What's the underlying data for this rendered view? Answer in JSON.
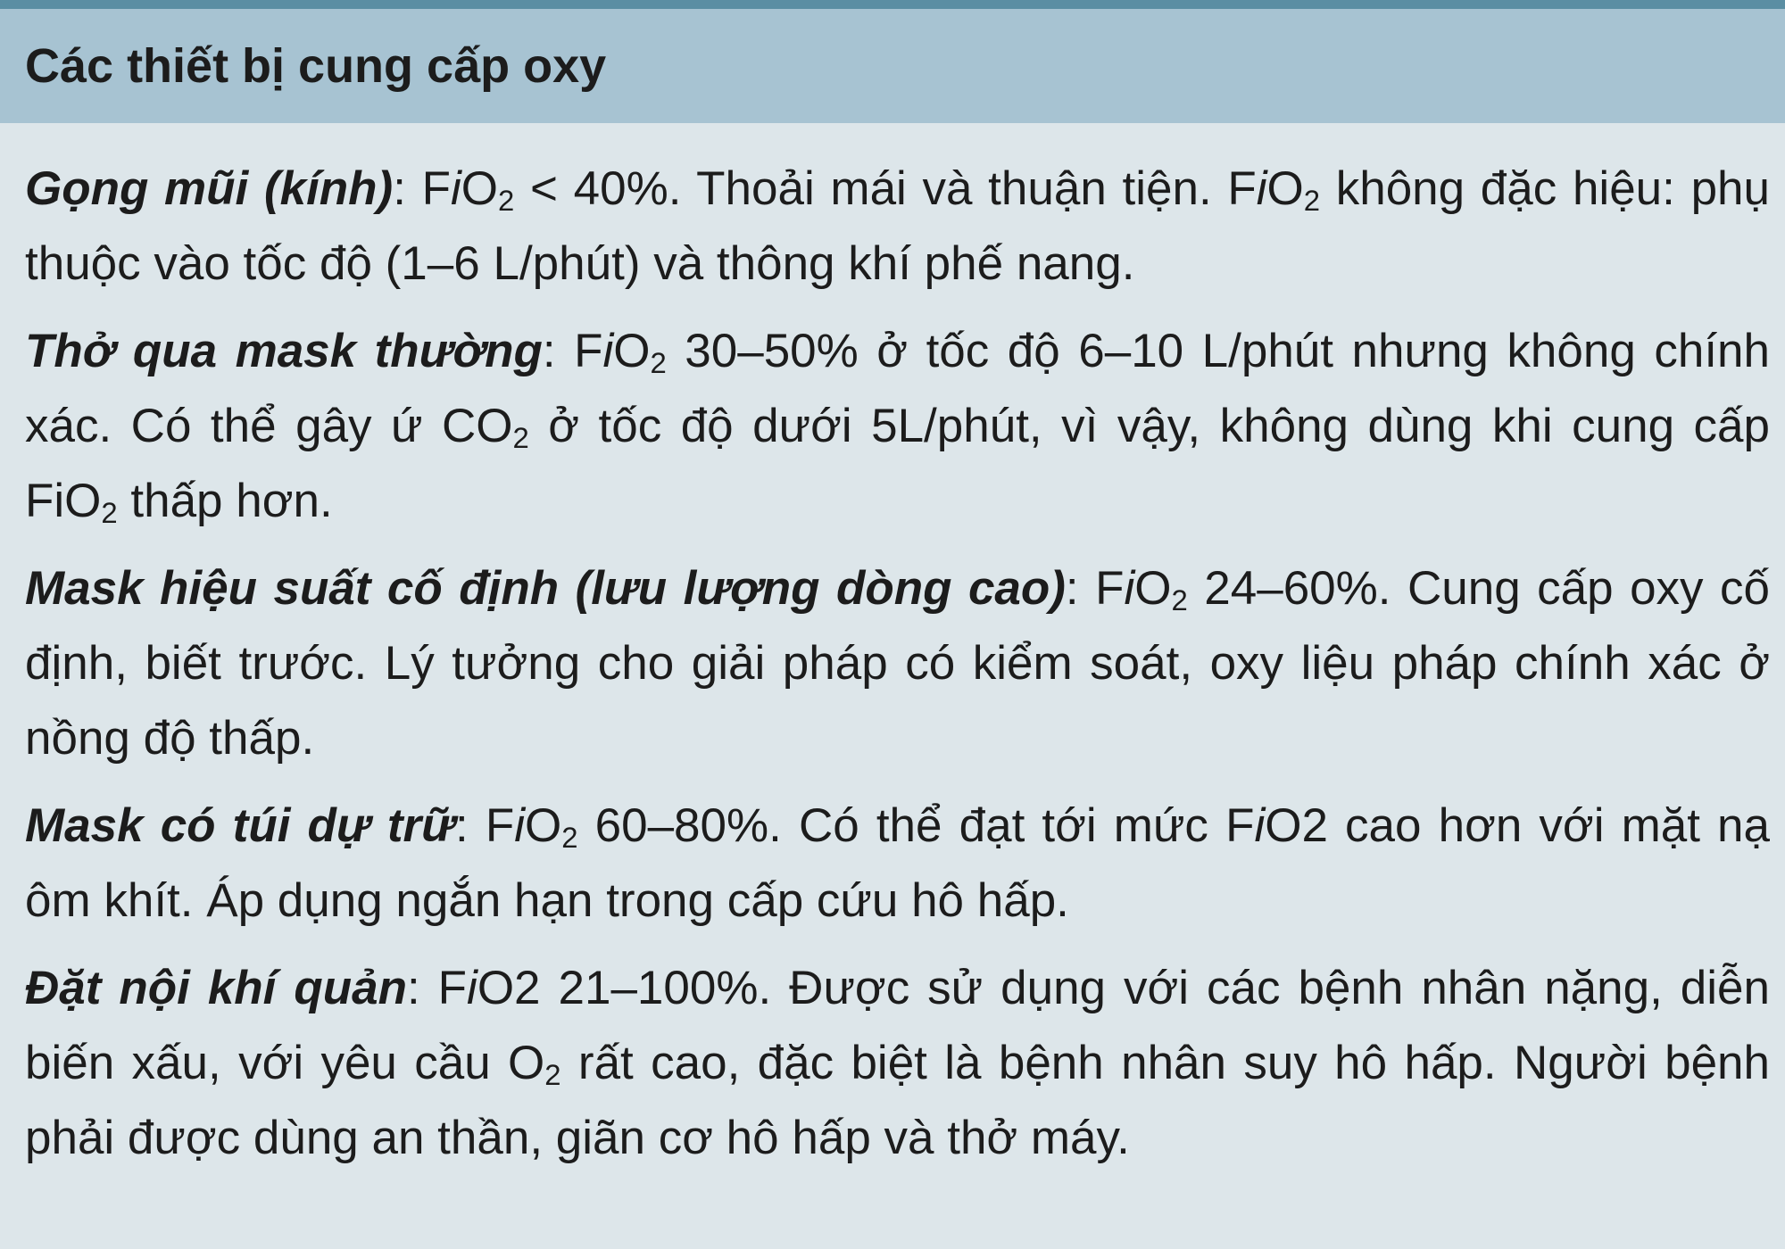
{
  "title": "Các thiết bị cung cấp oxy",
  "entries": [
    {
      "term": "Gọng mũi (kính)",
      "fio2_prefix": "F",
      "fio2_i": "i",
      "fio2_o": "O",
      "fio2_sub": "2",
      "range": " < 40%. Thoải mái và thuận tiện. ",
      "fio2b_prefix": "F",
      "fio2b_i": "i",
      "fio2b_o": "O",
      "fio2b_sub": "2",
      "rest": "  không đặc hiệu: phụ thuộc vào tốc độ (1–6 L/phút) và thông khí phế nang."
    },
    {
      "term": "Thở qua mask thường",
      "fio2_prefix": "F",
      "fio2_i": "i",
      "fio2_o": "O",
      "fio2_sub": "2",
      "rest_a": " 30–50% ở tốc độ 6–10 L/phút nhưng không chính xác. Có thể gây ứ CO",
      "co2_sub": "2",
      "rest_b": " ở tốc độ dưới 5L/phút, vì vậy, không dùng khi cung cấp FiO",
      "fio2c_sub": "2",
      "rest_c": " thấp hơn."
    },
    {
      "term": "Mask hiệu suất cố định (lưu lượng dòng cao)",
      "fio2_prefix": "F",
      "fio2_i": "i",
      "fio2_o": "O",
      "fio2_sub": "2",
      "rest": "  24–60%. Cung cấp oxy cố định, biết trước. Lý tưởng cho giải pháp có kiểm soát, oxy liệu pháp chính xác ở nồng độ thấp."
    },
    {
      "term": "Mask có túi dự trữ",
      "fio2_prefix": "F",
      "fio2_i": "i",
      "fio2_o": "O",
      "fio2_sub": "2",
      "rest_a": " 60–80%. Có thể đạt tới mức ",
      "fio2b_prefix": "F",
      "fio2b_i": "i",
      "fio2b_rest": "O2",
      "rest_b": " cao hơn với mặt nạ ôm khít. Áp dụng ngắn hạn trong cấp cứu hô hấp."
    },
    {
      "term": "Đặt nội khí quản",
      "fio2_prefix": "F",
      "fio2_i": "i",
      "fio2_rest": "O2",
      "rest_a": " 21–100%. Được sử dụng với các bệnh nhân nặng, diễn biến xấu, với yêu cầu O",
      "o2_sub": "2",
      "rest_b": " rất cao, đặc biệt là bệnh nhân suy hô hấp. Người bệnh phải được dùng an thần, giãn cơ hô hấp và thở máy."
    }
  ],
  "colors": {
    "header_bg": "#a7c3d2",
    "body_bg": "#dde6ea",
    "top_rule": "#5b8ea3",
    "text": "#1c1c1c"
  }
}
